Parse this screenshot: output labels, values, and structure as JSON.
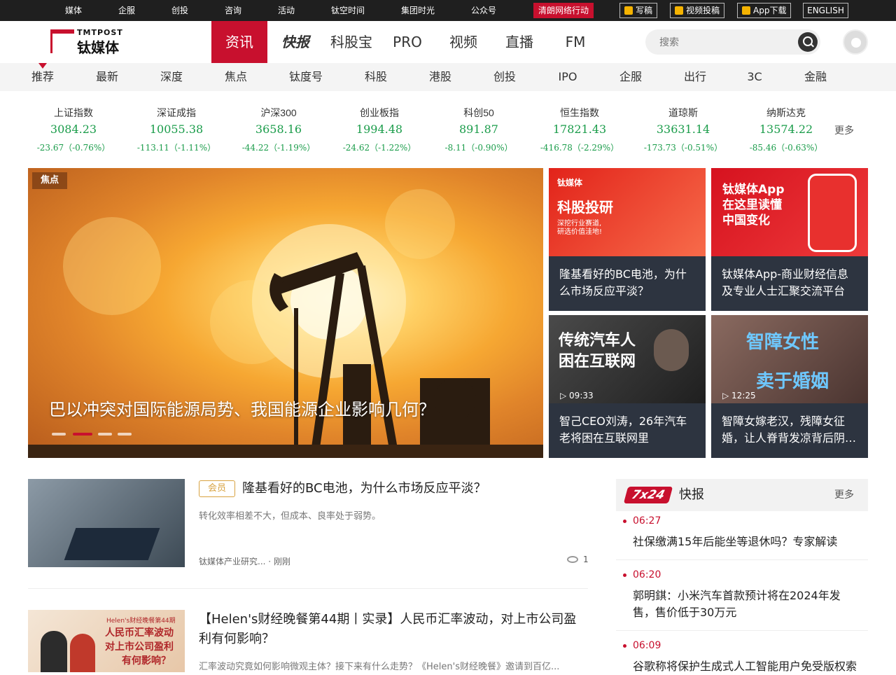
{
  "topbar": {
    "links": [
      "媒体",
      "企服",
      "创投",
      "咨询",
      "活动",
      "钛空时间",
      "集团时光",
      "公众号"
    ],
    "highlight": "清朗网络行动",
    "buttons": [
      "写稿",
      "视频投稿",
      "App下载"
    ],
    "english": "ENGLISH"
  },
  "logo": {
    "sub": "TMTPOST",
    "name": "钛媒体"
  },
  "nav": {
    "items": [
      "资讯",
      "快报",
      "科股宝",
      "PRO",
      "视频",
      "直播",
      "FM"
    ],
    "active": "资讯"
  },
  "search": {
    "placeholder": "搜索"
  },
  "subnav": {
    "items": [
      "推荐",
      "最新",
      "深度",
      "焦点",
      "钛度号",
      "科股",
      "港股",
      "创投",
      "IPO",
      "企服",
      "出行",
      "3C",
      "金融"
    ]
  },
  "indices": [
    {
      "name": "上证指数",
      "value": "3084.23",
      "change": "-23.67（-0.76%）"
    },
    {
      "name": "深证成指",
      "value": "10055.38",
      "change": "-113.11（-1.11%）"
    },
    {
      "name": "沪深300",
      "value": "3658.16",
      "change": "-44.22（-1.19%）"
    },
    {
      "name": "创业板指",
      "value": "1994.48",
      "change": "-24.62（-1.22%）"
    },
    {
      "name": "科创50",
      "value": "891.87",
      "change": "-8.11（-0.90%）"
    },
    {
      "name": "恒生指数",
      "value": "17821.43",
      "change": "-416.78（-2.29%）"
    },
    {
      "name": "道琼斯",
      "value": "33631.14",
      "change": "-173.73（-0.51%）"
    },
    {
      "name": "纳斯达克",
      "value": "13574.22",
      "change": "-85.46（-0.63%）"
    }
  ],
  "indices_more": "更多",
  "hero": {
    "tag": "焦点",
    "title": "巴以冲突对国际能源局势、我国能源企业影响几何？"
  },
  "cards": [
    {
      "text": "隆基看好的BC电池，为什么市场反应平淡？",
      "img_lines": [
        "钛媒体",
        "科股投研",
        "深挖行业赛道,",
        "研选价值洼地!"
      ]
    },
    {
      "text": "钛媒体App-商业财经信息及专业人士汇聚交流平台",
      "img_lines": [
        "钛媒体App",
        "在这里读懂",
        "中国变化"
      ]
    },
    {
      "text": "智己CEO刘涛，26年汽车老将困在互联网里",
      "duration": "09:33",
      "img_lines": [
        "传统汽车人",
        "困在互联网"
      ]
    },
    {
      "text": "智障女嫁老汉，残障女征婚，让人脊背发凉背后阴…",
      "duration": "12:25",
      "img_lines": [
        "智障女性",
        "卖于婚姻"
      ]
    }
  ],
  "articles": [
    {
      "badge": "会员",
      "title": "隆基看好的BC电池，为什么市场反应平淡？",
      "desc": "转化效率相差不大，但成本、良率处于弱势。",
      "meta": "钛媒体产业研究... · 刚刚",
      "views": "1"
    },
    {
      "title": "【Helen's财经晚餐第44期丨实录】人民币汇率波动，对上市公司盈利有何影响？",
      "desc": "汇率波动究竟如何影响微观主体？接下来有什么走势？《Helen's财经晚餐》邀请到百亿...",
      "img_lines": [
        "Helen's财经晚餐第44期",
        "人民币汇率波动",
        "对上市公司盈利",
        "有何影响？"
      ]
    }
  ],
  "flash": {
    "badge": "7x24",
    "title": "快报",
    "more": "更多",
    "items": [
      {
        "time": "06:27",
        "text": "社保缴满15年后能坐等退休吗？专家解读"
      },
      {
        "time": "06:20",
        "text": "郭明錤：小米汽车首款预计将在2024年发售，售价低于30万元"
      },
      {
        "time": "06:09",
        "text": "谷歌称将保护生成式人工智能用户免受版权索"
      }
    ]
  }
}
